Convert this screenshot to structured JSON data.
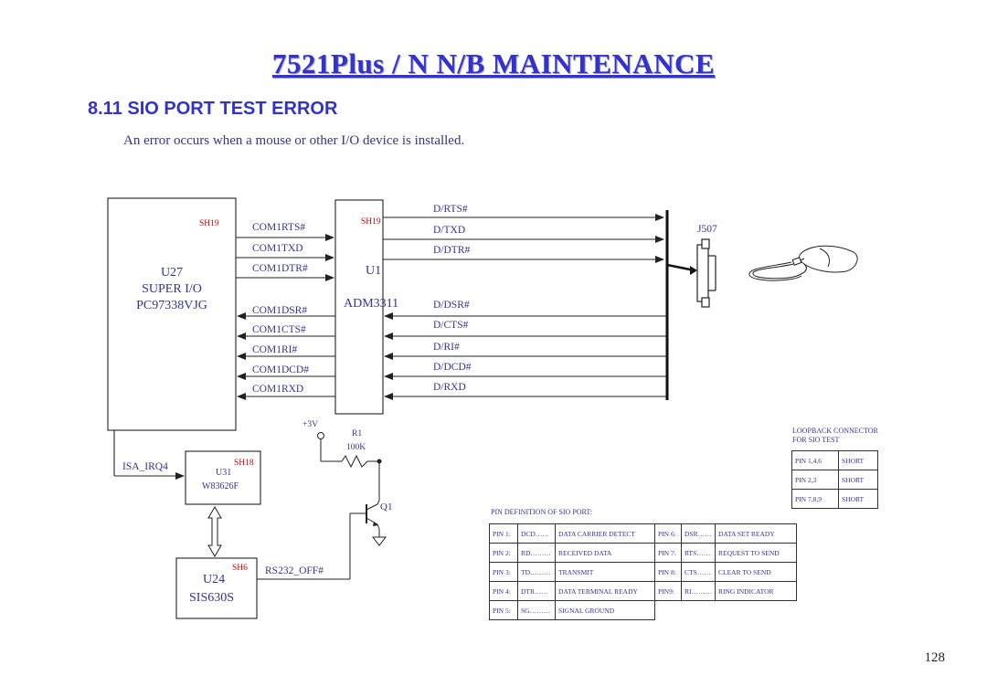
{
  "header": {
    "title": "7521Plus / N  N/B  MAINTENANCE",
    "section": "8.11 SIO PORT TEST ERROR",
    "description": "An error occurs when a mouse or other I/O device is installed."
  },
  "chips": {
    "u27": {
      "name": "U27",
      "line2": "SUPER I/O",
      "line3": "PC97338VJG",
      "sheet": "SH19"
    },
    "u1": {
      "name": "U1",
      "part": "ADM3311",
      "sheet": "SH19"
    },
    "u31": {
      "name": "U31",
      "part": "W83626F",
      "sheet": "SH18"
    },
    "u24": {
      "name": "U24",
      "part": "SIS630S",
      "sheet": "SH6"
    }
  },
  "signals": {
    "left": [
      "COM1RTS#",
      "COM1TXD",
      "COM1DTR#",
      "COM1DSR#",
      "COM1CTS#",
      "COM1RI#",
      "COM1DCD#",
      "COM1RXD"
    ],
    "right": [
      "D/RTS#",
      "D/TXD",
      "D/DTR#",
      "D/DSR#",
      "D/CTS#",
      "D/RI#",
      "D/DCD#",
      "D/RXD"
    ],
    "isa_irq": "ISA_IRQ4",
    "rs232_off": "RS232_OFF#"
  },
  "components": {
    "connector": "J507",
    "resistor_name": "R1",
    "resistor_value": "100K",
    "transistor": "Q1",
    "vcc": "+3V"
  },
  "loopback": {
    "title_line1": "LOOPBACK CONNECTOR",
    "title_line2": "FOR SIO TEST",
    "rows": [
      [
        "PIN 1,4,6",
        "SHORT"
      ],
      [
        "PIN 2,3",
        "SHORT"
      ],
      [
        "PIN 7,8,9",
        "SHORT"
      ]
    ]
  },
  "pin_definition": {
    "title": "PIN DEFINITION OF SIO PORT:",
    "rows": [
      [
        "PIN 1:",
        "DCD……",
        "DATA CARRIER DETECT",
        "PIN 6:",
        "DSR……",
        "DATA SET READY"
      ],
      [
        "PIN 2:",
        "RD………",
        "RECEIVED DATA",
        "PIN 7:",
        "RTS……",
        "REQUEST TO SEND"
      ],
      [
        "PIN 3:",
        "TD………",
        "TRANSMIT",
        "PIN 8:",
        "CTS……",
        "CLEAR TO SEND"
      ],
      [
        "PIN 4:",
        "DTR……",
        "DATA TERMINAL READY",
        "PIN9:",
        "RI………",
        "RING INDICATOR"
      ],
      [
        "PIN 5:",
        "SG………",
        "SIGNAL GROUND",
        "",
        "",
        ""
      ]
    ]
  },
  "page_number": "128"
}
